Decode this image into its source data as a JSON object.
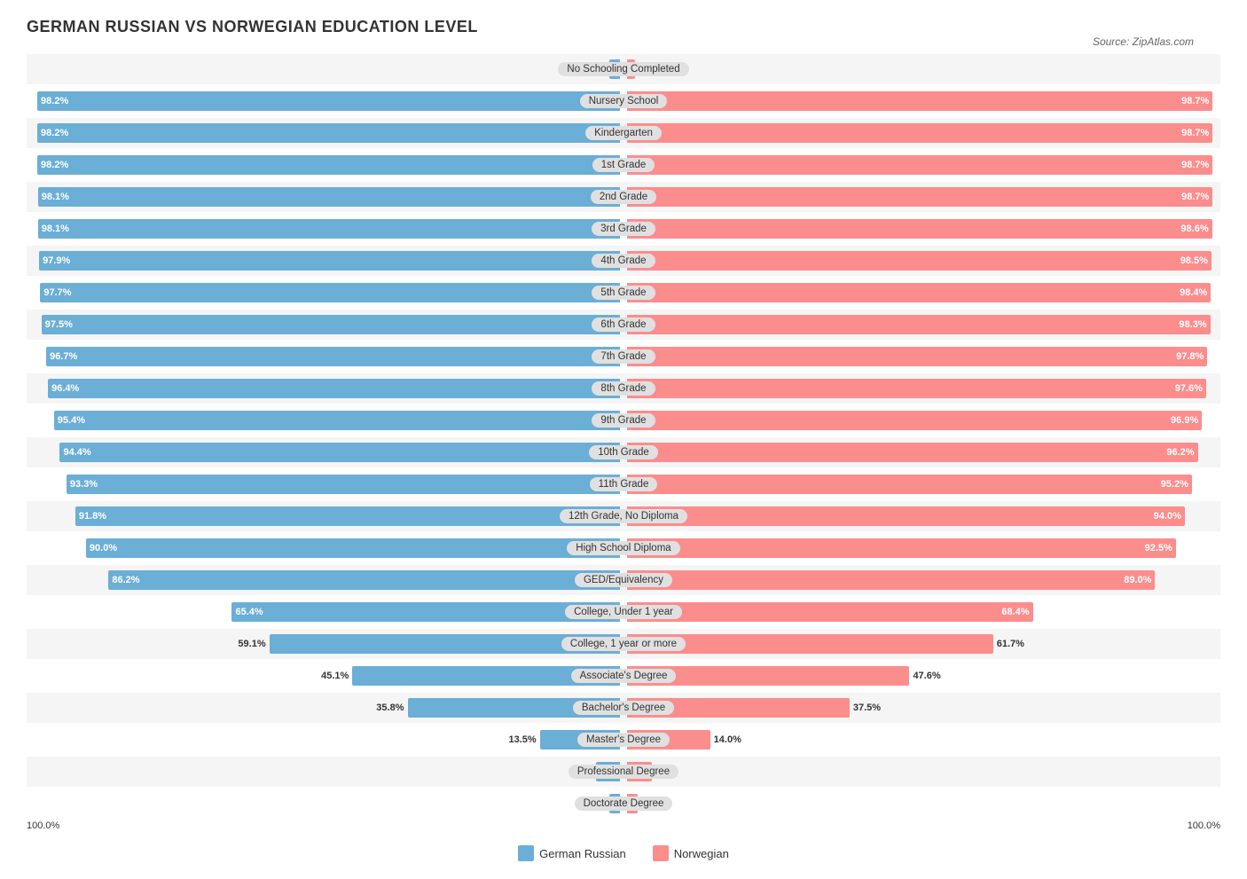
{
  "title": "GERMAN RUSSIAN VS NORWEGIAN EDUCATION LEVEL",
  "source": "Source: ZipAtlas.com",
  "colors": {
    "left": "#6baed6",
    "right": "#fc8d8d",
    "center_label_bg": "#d0d0d0"
  },
  "legend": {
    "left_label": "German Russian",
    "right_label": "Norwegian"
  },
  "axis": {
    "left": "100.0%",
    "right": "100.0%"
  },
  "rows": [
    {
      "label": "No Schooling Completed",
      "left_val": 1.8,
      "left_pct": "1.8%",
      "right_val": 1.3,
      "right_pct": "1.3%",
      "left_inside": false,
      "right_inside": false
    },
    {
      "label": "Nursery School",
      "left_val": 98.2,
      "left_pct": "98.2%",
      "right_val": 98.7,
      "right_pct": "98.7%",
      "left_inside": true,
      "right_inside": true
    },
    {
      "label": "Kindergarten",
      "left_val": 98.2,
      "left_pct": "98.2%",
      "right_val": 98.7,
      "right_pct": "98.7%",
      "left_inside": true,
      "right_inside": true
    },
    {
      "label": "1st Grade",
      "left_val": 98.2,
      "left_pct": "98.2%",
      "right_val": 98.7,
      "right_pct": "98.7%",
      "left_inside": true,
      "right_inside": true
    },
    {
      "label": "2nd Grade",
      "left_val": 98.1,
      "left_pct": "98.1%",
      "right_val": 98.7,
      "right_pct": "98.7%",
      "left_inside": true,
      "right_inside": true
    },
    {
      "label": "3rd Grade",
      "left_val": 98.1,
      "left_pct": "98.1%",
      "right_val": 98.6,
      "right_pct": "98.6%",
      "left_inside": true,
      "right_inside": true
    },
    {
      "label": "4th Grade",
      "left_val": 97.9,
      "left_pct": "97.9%",
      "right_val": 98.5,
      "right_pct": "98.5%",
      "left_inside": true,
      "right_inside": true
    },
    {
      "label": "5th Grade",
      "left_val": 97.7,
      "left_pct": "97.7%",
      "right_val": 98.4,
      "right_pct": "98.4%",
      "left_inside": true,
      "right_inside": true
    },
    {
      "label": "6th Grade",
      "left_val": 97.5,
      "left_pct": "97.5%",
      "right_val": 98.3,
      "right_pct": "98.3%",
      "left_inside": true,
      "right_inside": true
    },
    {
      "label": "7th Grade",
      "left_val": 96.7,
      "left_pct": "96.7%",
      "right_val": 97.8,
      "right_pct": "97.8%",
      "left_inside": true,
      "right_inside": true
    },
    {
      "label": "8th Grade",
      "left_val": 96.4,
      "left_pct": "96.4%",
      "right_val": 97.6,
      "right_pct": "97.6%",
      "left_inside": true,
      "right_inside": true
    },
    {
      "label": "9th Grade",
      "left_val": 95.4,
      "left_pct": "95.4%",
      "right_val": 96.9,
      "right_pct": "96.9%",
      "left_inside": true,
      "right_inside": true
    },
    {
      "label": "10th Grade",
      "left_val": 94.4,
      "left_pct": "94.4%",
      "right_val": 96.2,
      "right_pct": "96.2%",
      "left_inside": true,
      "right_inside": true
    },
    {
      "label": "11th Grade",
      "left_val": 93.3,
      "left_pct": "93.3%",
      "right_val": 95.2,
      "right_pct": "95.2%",
      "left_inside": true,
      "right_inside": true
    },
    {
      "label": "12th Grade, No Diploma",
      "left_val": 91.8,
      "left_pct": "91.8%",
      "right_val": 94.0,
      "right_pct": "94.0%",
      "left_inside": true,
      "right_inside": true
    },
    {
      "label": "High School Diploma",
      "left_val": 90.0,
      "left_pct": "90.0%",
      "right_val": 92.5,
      "right_pct": "92.5%",
      "left_inside": true,
      "right_inside": true
    },
    {
      "label": "GED/Equivalency",
      "left_val": 86.2,
      "left_pct": "86.2%",
      "right_val": 89.0,
      "right_pct": "89.0%",
      "left_inside": true,
      "right_inside": true
    },
    {
      "label": "College, Under 1 year",
      "left_val": 65.4,
      "left_pct": "65.4%",
      "right_val": 68.4,
      "right_pct": "68.4%",
      "left_inside": true,
      "right_inside": true
    },
    {
      "label": "College, 1 year or more",
      "left_val": 59.1,
      "left_pct": "59.1%",
      "right_val": 61.7,
      "right_pct": "61.7%",
      "left_inside": false,
      "right_inside": false
    },
    {
      "label": "Associate's Degree",
      "left_val": 45.1,
      "left_pct": "45.1%",
      "right_val": 47.6,
      "right_pct": "47.6%",
      "left_inside": false,
      "right_inside": false
    },
    {
      "label": "Bachelor's Degree",
      "left_val": 35.8,
      "left_pct": "35.8%",
      "right_val": 37.5,
      "right_pct": "37.5%",
      "left_inside": false,
      "right_inside": false
    },
    {
      "label": "Master's Degree",
      "left_val": 13.5,
      "left_pct": "13.5%",
      "right_val": 14.0,
      "right_pct": "14.0%",
      "left_inside": false,
      "right_inside": false
    },
    {
      "label": "Professional Degree",
      "left_val": 4.0,
      "left_pct": "4.0%",
      "right_val": 4.2,
      "right_pct": "4.2%",
      "left_inside": false,
      "right_inside": false
    },
    {
      "label": "Doctorate Degree",
      "left_val": 1.8,
      "left_pct": "1.8%",
      "right_val": 1.8,
      "right_pct": "1.8%",
      "left_inside": false,
      "right_inside": false
    }
  ]
}
